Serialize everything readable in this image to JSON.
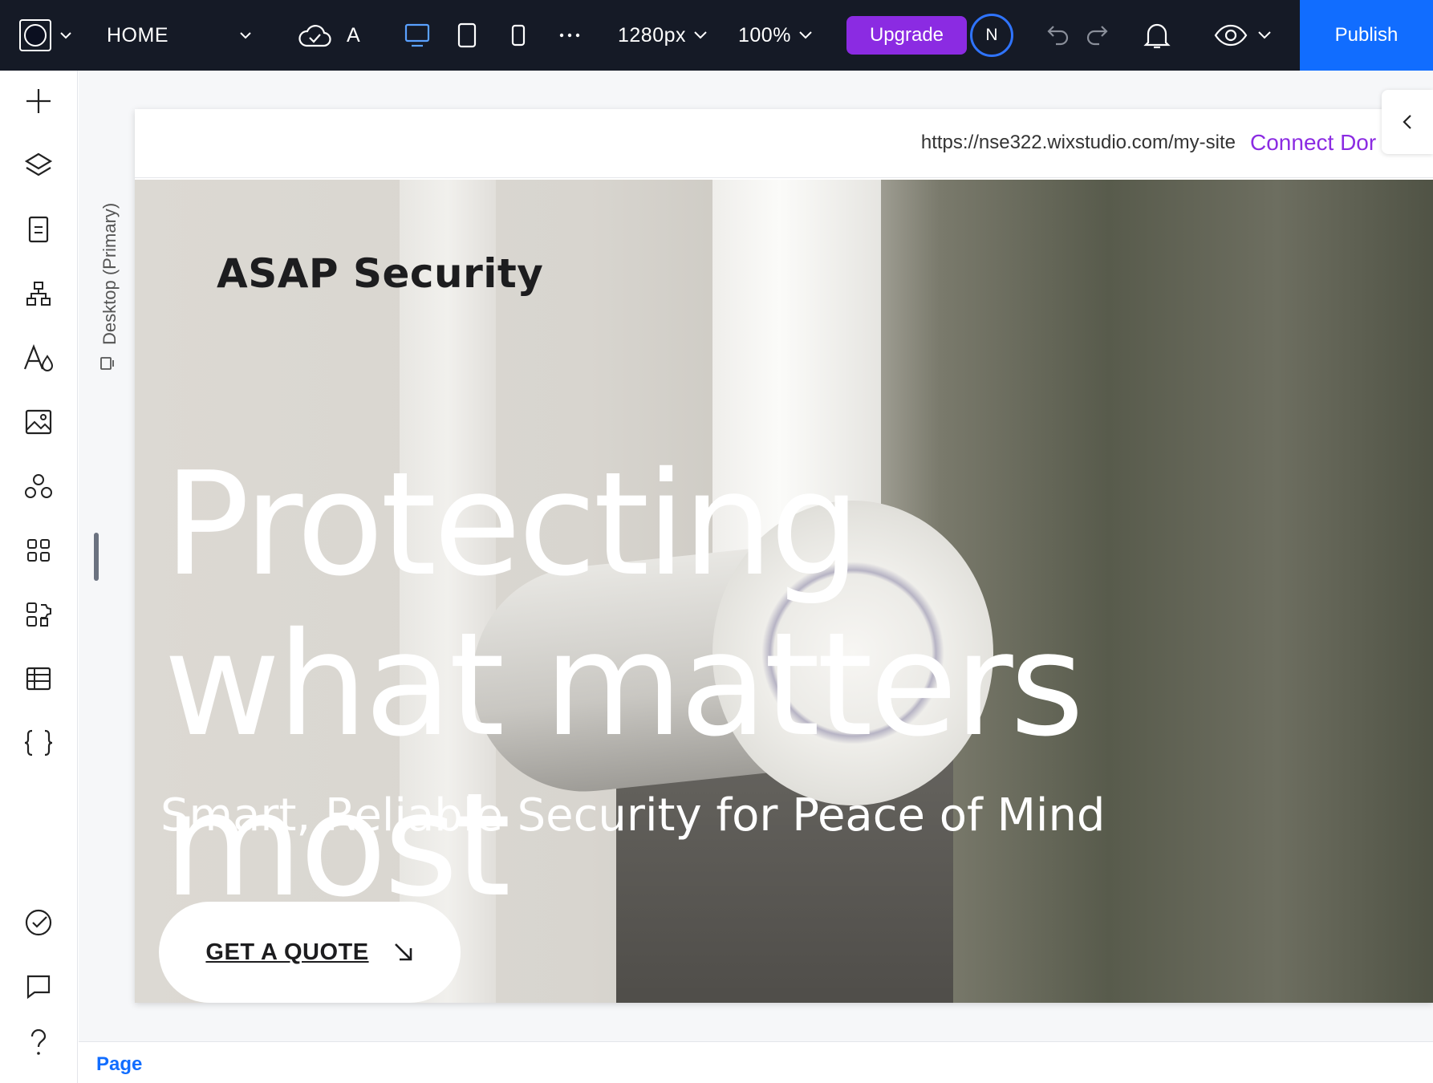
{
  "topbar": {
    "page_name": "HOME",
    "site_status_letter": "A",
    "width_value": "1280px",
    "zoom_value": "100%",
    "upgrade_label": "Upgrade",
    "avatar_initial": "N",
    "publish_label": "Publish",
    "icons": [
      "site-logo-icon",
      "chevron-down-icon",
      "cloud-check-icon",
      "desktop-icon",
      "tablet-icon",
      "mobile-icon",
      "more-icon",
      "undo-icon",
      "redo-icon",
      "bell-icon",
      "eye-icon"
    ]
  },
  "leftbar": {
    "icons": [
      "add-icon",
      "layers-icon",
      "pages-icon",
      "sitemap-icon",
      "typography-icon",
      "media-icon",
      "components-icon",
      "apps-icon",
      "app-market-icon",
      "cms-icon",
      "code-icon",
      "site-check-icon",
      "comments-icon",
      "help-icon"
    ]
  },
  "canvas": {
    "breakpoint_label": "Desktop (Primary)",
    "url": "https://nse322.wixstudio.com/my-site",
    "connect_label": "Connect Dor"
  },
  "hero": {
    "brand": "ASAP Security",
    "headline": "Protecting what matters most",
    "subline": "Smart, Reliable Security for Peace of Mind",
    "cta_label": "GET A QUOTE"
  },
  "bottombar": {
    "page_label": "Page"
  },
  "colors": {
    "topbar_bg": "#151a26",
    "upgrade": "#8b2be2",
    "publish": "#116dff",
    "accent_link": "#8b2be2"
  }
}
